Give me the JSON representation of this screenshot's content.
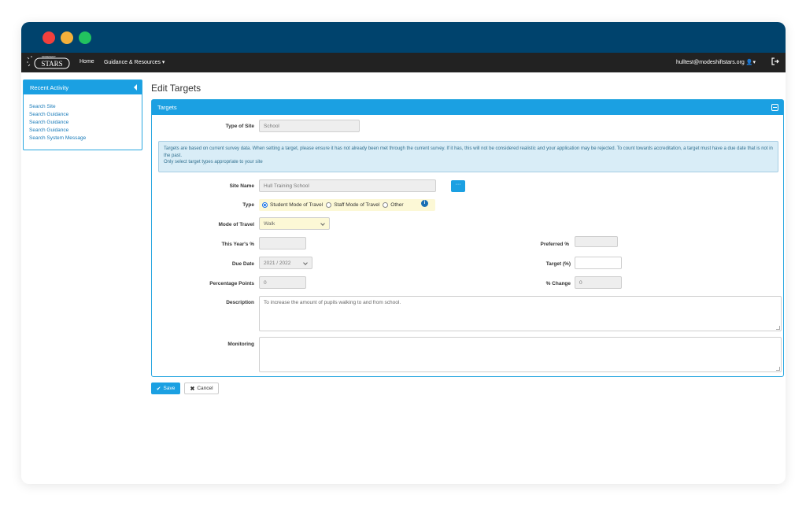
{
  "nav": {
    "logo_text": "STARS",
    "logo_subtext": "MODESHIFT",
    "home": "Home",
    "guidance": "Guidance & Resources",
    "user_email": "hulltest@modeshiftstars.org"
  },
  "sidebar": {
    "title": "Recent Activity",
    "links": [
      "Search Site",
      "Search Guidance",
      "Search Guidance",
      "Search Guidance",
      "Search System Message"
    ]
  },
  "page": {
    "title": "Edit Targets"
  },
  "panel": {
    "title": "Targets"
  },
  "form": {
    "type_of_site_label": "Type of Site",
    "type_of_site_value": "School",
    "info_text_1": "Targets are based on current survey data. When setting a target, please ensure it has not already been met through the current survey. If it has, this will not be considered realistic and your application may be rejected. To count towards accreditation, a target must have a due date that is not in the past.",
    "info_text_2": "Only select target types appropriate to your site",
    "site_name_label": "Site Name",
    "site_name_value": "Hull Training School",
    "ellipsis_label": "···",
    "type_label": "Type",
    "type_options": [
      "Student Mode of Travel",
      "Staff Mode of Travel",
      "Other"
    ],
    "type_selected": "Student Mode of Travel",
    "mode_label": "Mode of Travel",
    "mode_value": "Walk",
    "this_year_label": "This Year's %",
    "this_year_value": "",
    "preferred_label": "Preferred %",
    "preferred_value": "",
    "due_date_label": "Due Date",
    "due_date_value": "2021 / 2022",
    "target_label": "Target (%)",
    "target_value": "",
    "pp_label": "Percentage Points",
    "pp_value": "0",
    "change_label": "% Change",
    "change_value": "0",
    "description_label": "Description",
    "description_value": "To increase the amount of pupils walking to and from school.",
    "monitoring_label": "Monitoring",
    "monitoring_value": ""
  },
  "actions": {
    "save": "Save",
    "cancel": "Cancel"
  },
  "colors": {
    "titlebar": "#00436d",
    "accent": "#1ba0e2",
    "navbar": "#222222"
  }
}
